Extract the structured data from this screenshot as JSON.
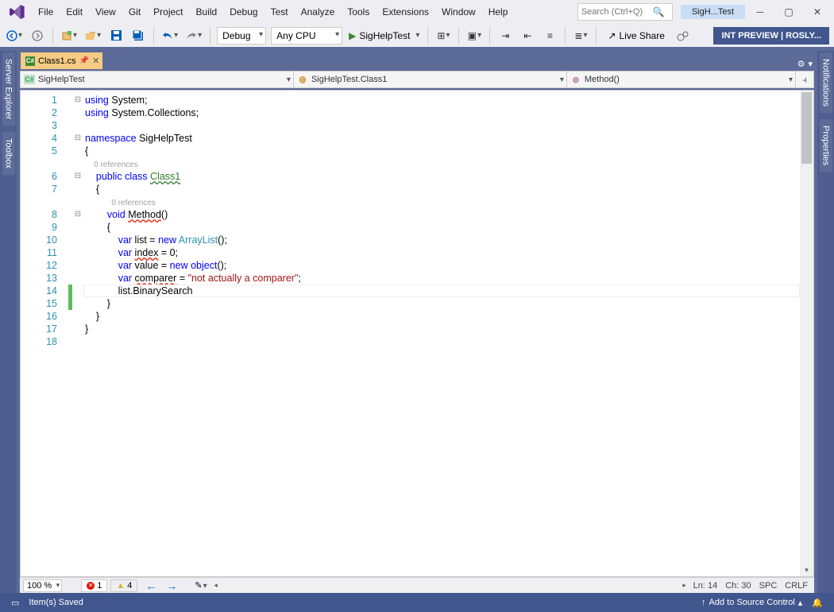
{
  "menu": [
    "File",
    "Edit",
    "View",
    "Git",
    "Project",
    "Build",
    "Debug",
    "Test",
    "Analyze",
    "Tools",
    "Extensions",
    "Window",
    "Help"
  ],
  "search_placeholder": "Search (Ctrl+Q)",
  "title_pill": "SigH...Test",
  "toolbar": {
    "config": "Debug",
    "platform": "Any CPU",
    "start": "SigHelpTest",
    "live_share": "Live Share",
    "preview": "INT PREVIEW | ROSLY..."
  },
  "side_left": [
    "Server Explorer",
    "Toolbox"
  ],
  "side_right": [
    "Notifications",
    "Properties"
  ],
  "file_tab": {
    "name": "Class1.cs"
  },
  "navbar": {
    "project": "SigHelpTest",
    "class": "SigHelpTest.Class1",
    "method": "Method()"
  },
  "code_lines": [
    {
      "n": 1,
      "frag": [
        [
          "kw",
          "using"
        ],
        [
          "",
          " System;"
        ]
      ]
    },
    {
      "n": 2,
      "frag": [
        [
          "kw",
          "using"
        ],
        [
          "",
          " System.Collections;"
        ]
      ]
    },
    {
      "n": 3,
      "frag": []
    },
    {
      "n": 4,
      "frag": [
        [
          "kw",
          "namespace"
        ],
        [
          "",
          " SigHelpTest"
        ]
      ]
    },
    {
      "n": 5,
      "frag": [
        [
          "",
          "{"
        ]
      ]
    },
    {
      "ref": "0 references"
    },
    {
      "n": 6,
      "frag": [
        [
          "",
          "    "
        ],
        [
          "kw",
          "public"
        ],
        [
          "",
          " "
        ],
        [
          "kw",
          "class"
        ],
        [
          "",
          " "
        ],
        [
          "type sq-green",
          "Class1"
        ]
      ]
    },
    {
      "n": 7,
      "frag": [
        [
          "",
          "    {"
        ]
      ]
    },
    {
      "ref": "        0 references"
    },
    {
      "n": 8,
      "frag": [
        [
          "",
          "        "
        ],
        [
          "kw",
          "void"
        ],
        [
          "",
          " "
        ],
        [
          "err",
          "Method"
        ],
        [
          "",
          "()"
        ]
      ]
    },
    {
      "n": 9,
      "frag": [
        [
          "",
          "        {"
        ]
      ]
    },
    {
      "n": 10,
      "frag": [
        [
          "",
          "            "
        ],
        [
          "kw",
          "var"
        ],
        [
          "",
          " list = "
        ],
        [
          "kw",
          "new"
        ],
        [
          "",
          " "
        ],
        [
          "type",
          "ArrayList"
        ],
        [
          "",
          "();"
        ]
      ]
    },
    {
      "n": 11,
      "frag": [
        [
          "",
          "            "
        ],
        [
          "kw",
          "var"
        ],
        [
          "",
          " "
        ],
        [
          "err",
          "index"
        ],
        [
          "",
          " = 0;"
        ]
      ]
    },
    {
      "n": 12,
      "frag": [
        [
          "",
          "            "
        ],
        [
          "kw",
          "var"
        ],
        [
          "",
          " value = "
        ],
        [
          "kw",
          "new"
        ],
        [
          "",
          " "
        ],
        [
          "kw",
          "object"
        ],
        [
          "",
          "();"
        ]
      ]
    },
    {
      "n": 13,
      "frag": [
        [
          "",
          "            "
        ],
        [
          "kw",
          "var"
        ],
        [
          "",
          " "
        ],
        [
          "err",
          "comparer"
        ],
        [
          "",
          " = "
        ],
        [
          "str",
          "\"not actually a comparer\""
        ],
        [
          "",
          ";"
        ]
      ]
    },
    {
      "n": 14,
      "frag": [
        [
          "",
          "            list.BinarySearch"
        ]
      ],
      "current": true,
      "changed": true
    },
    {
      "n": 15,
      "frag": [
        [
          "",
          "        }"
        ]
      ],
      "changed": true
    },
    {
      "n": 16,
      "frag": [
        [
          "",
          "    }"
        ]
      ]
    },
    {
      "n": 17,
      "frag": [
        [
          "",
          "}"
        ]
      ]
    },
    {
      "n": 18,
      "frag": []
    }
  ],
  "editstatus": {
    "zoom": "100 %",
    "errors": "1",
    "warnings": "4",
    "ln": "Ln: 14",
    "ch": "Ch: 30",
    "indent": "SPC",
    "eol": "CRLF"
  },
  "statusbar": {
    "left": "Item(s) Saved",
    "sc": "Add to Source Control"
  }
}
